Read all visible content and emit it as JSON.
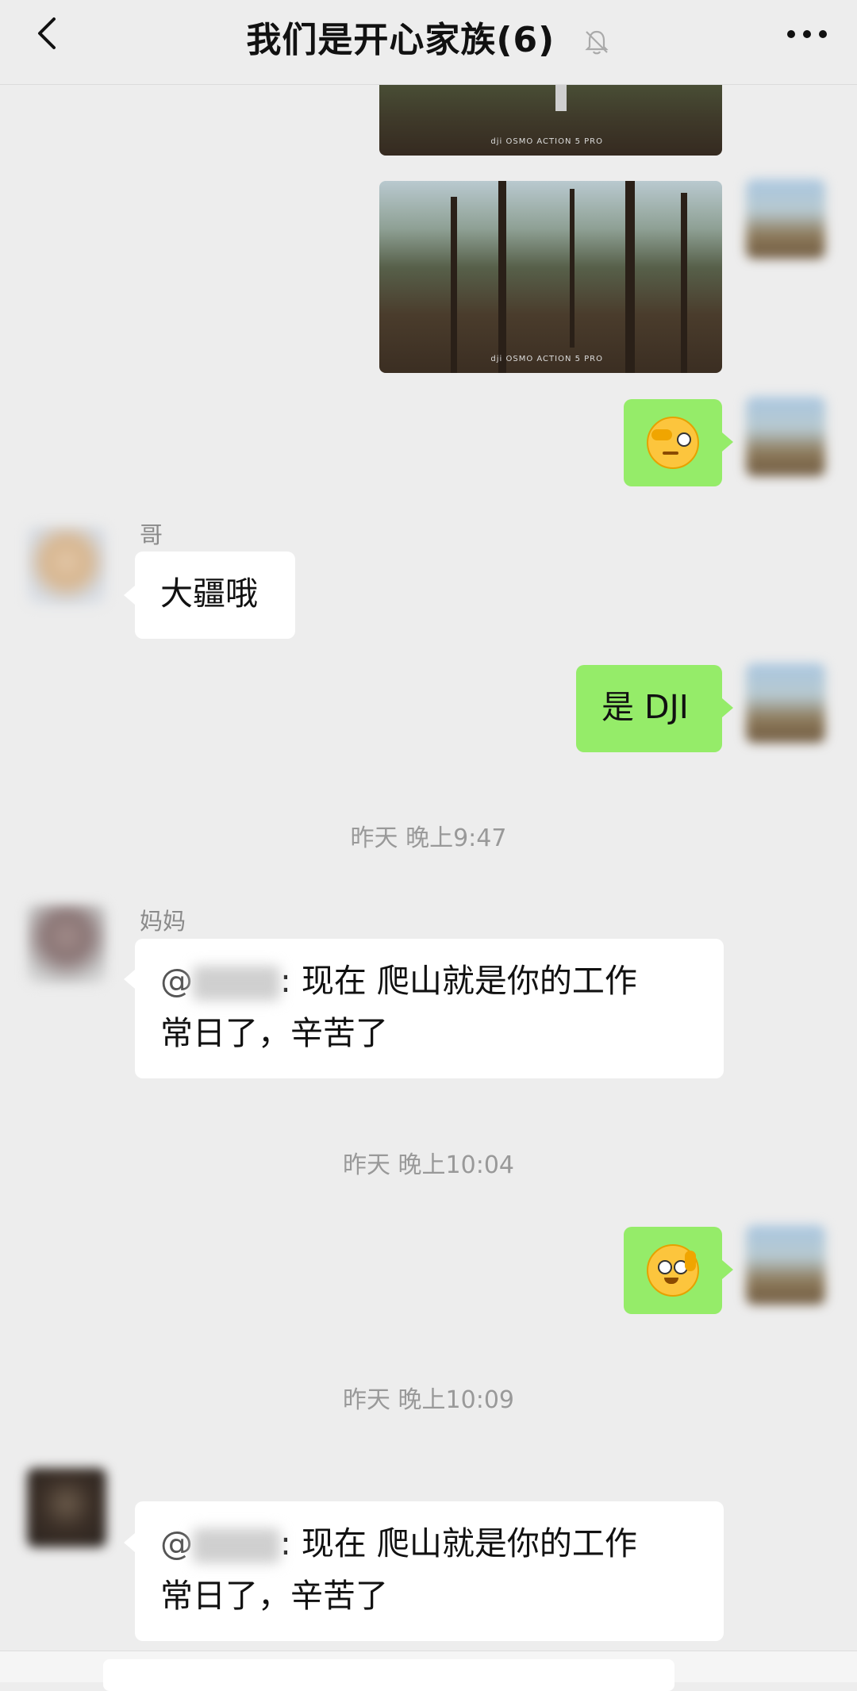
{
  "header": {
    "title": "我们是开心家族(6)"
  },
  "messages": {
    "ge": {
      "sender": "哥",
      "text": "大疆哦"
    },
    "me_dji": {
      "text": "是 DJI"
    },
    "time1": "昨天 晚上9:47",
    "mama": {
      "sender": "妈妈",
      "prefix": "@",
      "text_line1": ": 现在  爬山就是你的工作",
      "text_line2": "常日了，辛苦了"
    },
    "time2": "昨天 晚上10:04",
    "time3": "昨天 晚上10:09",
    "third": {
      "sender": "",
      "prefix": "@",
      "text_line1": ": 现在  爬山就是你的工作",
      "text_line2": "常日了，辛苦了"
    }
  },
  "photos": {
    "watermark": "dji OSMO ACTION 5 PRO"
  },
  "colors": {
    "background": "#ededed",
    "bubble_me": "#95ec69",
    "bubble_other": "#ffffff",
    "timestamp": "#999999"
  },
  "icons": [
    "back-arrow-icon",
    "mute-bell-icon",
    "more-dots-icon",
    "emoji-cover-eye-icon",
    "emoji-cheeky-icon"
  ]
}
